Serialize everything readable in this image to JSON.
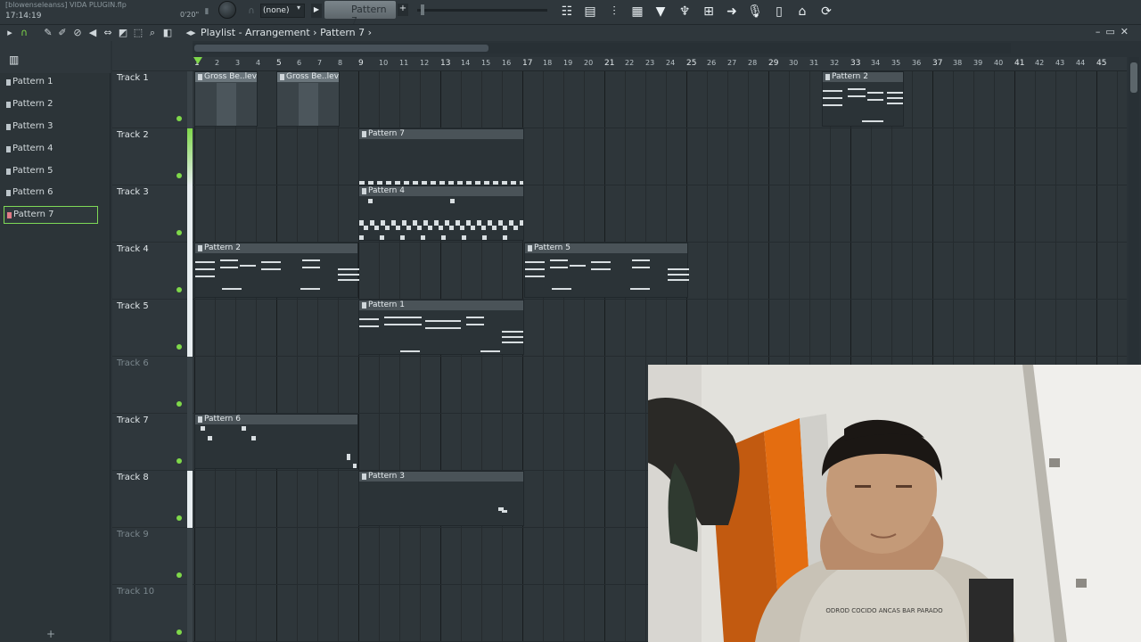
{
  "toolbar": {
    "project_title": "[blowenseleanss] VIDA  PLUGIN.flp",
    "clock": "17:14:19",
    "time_small": "0'20\"",
    "snap_select": "(none)",
    "pattern_select": "Pattern 7"
  },
  "playlist": {
    "title": "Playlist - Arrangement",
    "separator": "›",
    "pattern": "Pattern 7",
    "trailing": "›"
  },
  "picker": {
    "patterns": [
      "Pattern 1",
      "Pattern 2",
      "Pattern 3",
      "Pattern 4",
      "Pattern 5",
      "Pattern 6",
      "Pattern 7"
    ],
    "selected": "Pattern 7"
  },
  "ruler": {
    "bars": [
      "1",
      "2",
      "3",
      "4",
      "5",
      "6",
      "7",
      "8",
      "9",
      "10",
      "11",
      "12",
      "13",
      "14",
      "15",
      "16",
      "17",
      "18",
      "19",
      "20",
      "21",
      "22",
      "23",
      "24",
      "25",
      "26",
      "27",
      "28",
      "29",
      "30",
      "31",
      "32",
      "33",
      "34",
      "35",
      "36",
      "37",
      "38",
      "39",
      "40",
      "41",
      "42",
      "43",
      "44",
      "45"
    ]
  },
  "tracks": [
    "Track 1",
    "Track 2",
    "Track 3",
    "Track 4",
    "Track 5",
    "Track 6",
    "Track 7",
    "Track 8",
    "Track 9",
    "Track 10"
  ],
  "clips": {
    "gross_1": "Gross Be..level",
    "gross_2": "Gross Be..level",
    "t1_pattern2": "Pattern 2",
    "t2_pattern7": "Pattern 7",
    "t3_pattern4": "Pattern 4",
    "t4_pattern2": "Pattern 2",
    "t4_pattern5": "Pattern 5",
    "t5_pattern1": "Pattern 1",
    "t7_pattern6": "Pattern 6",
    "t8_pattern3": "Pattern 3"
  },
  "webcam": {
    "shirt_text": "ODROD COCIDO ANCAS BAR PARADO"
  },
  "colors": {
    "accent_green": "#7fd84a",
    "selected_pattern_marker": "#e07b86"
  }
}
